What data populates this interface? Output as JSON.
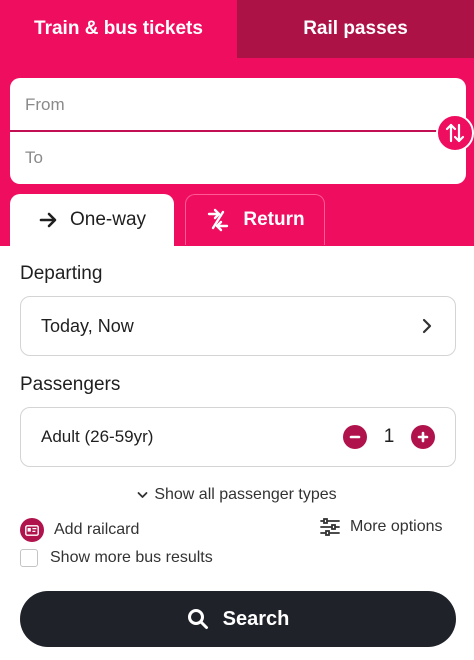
{
  "colors": {
    "brand": "#ef0d5f",
    "brand_dark": "#ad1246",
    "accent_dark": "#b0124c",
    "search_button": "#1f2329"
  },
  "top_tabs": [
    {
      "label": "Train & bus tickets",
      "active": true
    },
    {
      "label": "Rail passes",
      "active": false
    }
  ],
  "journey": {
    "from_placeholder": "From",
    "to_placeholder": "To",
    "swap_icon": "swap-vertical-icon"
  },
  "trip_type": {
    "oneway_label": "One-way",
    "oneway_icon": "arrow-right-icon",
    "return_label": "Return",
    "return_icon": "return-arrows-icon",
    "selected": "One-way"
  },
  "departing": {
    "label": "Departing",
    "value": "Today, Now",
    "icon": "chevron-right-icon"
  },
  "passengers": {
    "label": "Passengers",
    "type": "Adult (26-59yr)",
    "count": "1",
    "minus_icon": "minus-circle-icon",
    "plus_icon": "plus-circle-icon"
  },
  "options": {
    "show_types_label": "Show all passenger types",
    "add_railcard_label": "Add railcard",
    "more_options_label": "More options",
    "bus_results_label": "Show more bus results",
    "bus_results_checked": false
  },
  "search": {
    "label": "Search",
    "icon": "search-icon"
  }
}
